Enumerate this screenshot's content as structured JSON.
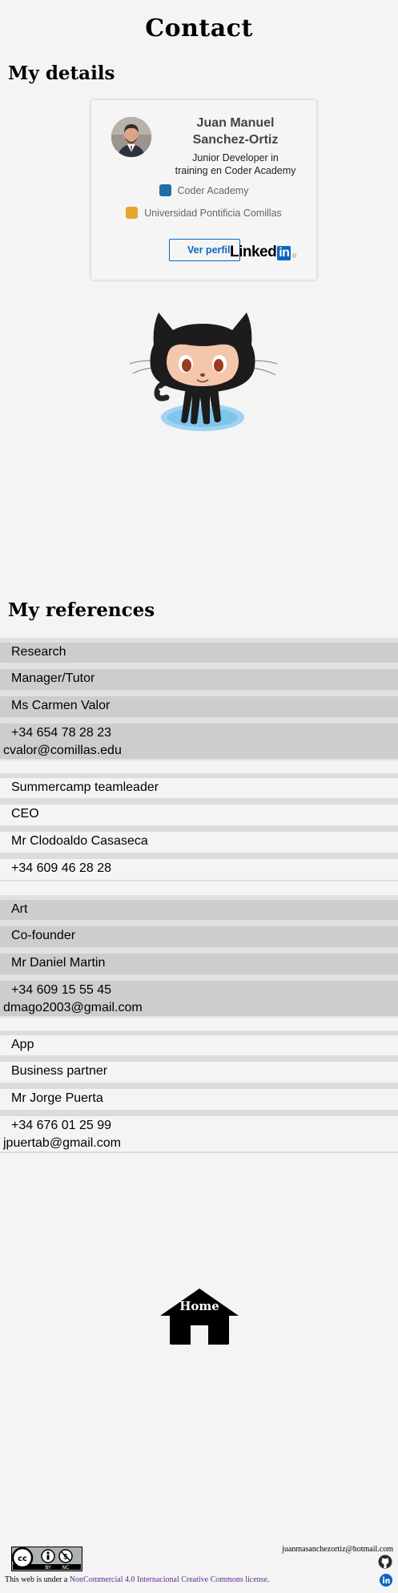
{
  "page": {
    "title": "Contact"
  },
  "details": {
    "heading": "My details",
    "profile": {
      "name_line1": "Juan Manuel",
      "name_line2": "Sanchez-Ortiz",
      "headline_line1": "Junior Developer in",
      "headline_line2": "training en Coder Academy",
      "companies": [
        "Coder Academy",
        "Universidad Pontificia Comillas"
      ],
      "button_label": "Ver perfil",
      "linkedin_word": "Linked",
      "linkedin_in": "in",
      "linkedin_reg": "®"
    },
    "mascot_icon": "github-octocat-icon"
  },
  "references": {
    "heading": "My references",
    "items": [
      {
        "field": "Research",
        "role": "Manager/Tutor",
        "name": "Ms Carmen Valor",
        "phone": "+34 654 78 28 23",
        "email": "cvalor@comillas.edu",
        "style": "dark"
      },
      {
        "field": "Summercamp teamleader",
        "role": "CEO",
        "name": "Mr Clodoaldo Casaseca",
        "phone": "+34 609 46 28 28",
        "email": "",
        "style": "light"
      },
      {
        "field": "Art",
        "role": "Co-founder",
        "name": "Mr Daniel Martin",
        "phone": "+34 609 15 55 45",
        "email": "dmago2003@gmail.com",
        "style": "dark"
      },
      {
        "field": "App",
        "role": "Business partner",
        "name": "Mr Jorge Puerta",
        "phone": "+34 676 01 25 99",
        "email": "jpuertab@gmail.com",
        "style": "light"
      }
    ]
  },
  "home": {
    "label": "Home",
    "icon": "house-icon"
  },
  "footer": {
    "email": "juanmasanchezortiz@hotmail.com",
    "license_prefix": "This web is under a ",
    "license_link": "NonCommercial 4.0 Internacional Creative Commons license",
    "license_suffix": ".",
    "badge_cc": "cc",
    "badge_by": "BY",
    "badge_nc": "NC",
    "icons": [
      "github-icon",
      "linkedin-icon"
    ]
  },
  "colors": {
    "background": "#f4f4f4",
    "linkedin_blue": "#0a66c2",
    "dark_row": "#cdcdcd",
    "link_purple": "#5a2d91"
  }
}
